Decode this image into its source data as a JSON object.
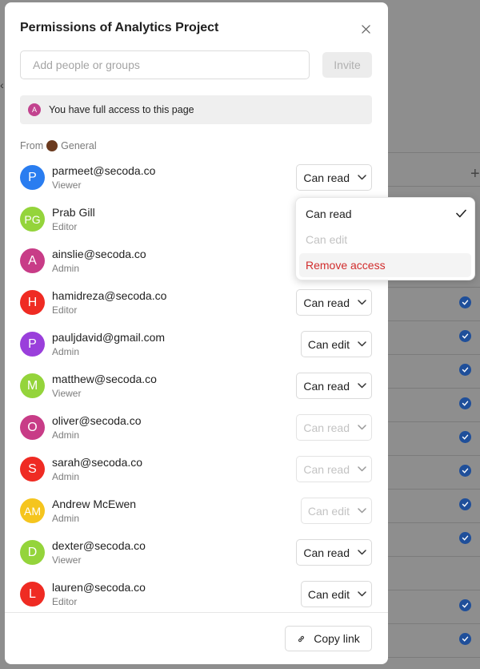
{
  "modal": {
    "title": "Permissions of Analytics Project",
    "search_placeholder": "Add people or groups",
    "invite_label": "Invite",
    "banner": {
      "avatar_letter": "A",
      "text": "You have full access to this page"
    },
    "from": {
      "prefix": "From",
      "source": "General"
    },
    "copy_link_label": "Copy link"
  },
  "members": [
    {
      "initials": "P",
      "name": "parmeet@secoda.co",
      "role": "Viewer",
      "permission": "Can read",
      "color": "#2a7df0"
    },
    {
      "initials": "PG",
      "name": "Prab Gill",
      "role": "Editor",
      "permission": "Can read",
      "color": "#94d43b"
    },
    {
      "initials": "A",
      "name": "ainslie@secoda.co",
      "role": "Admin",
      "permission": "Can read",
      "color": "#c83c87"
    },
    {
      "initials": "H",
      "name": "hamidreza@secoda.co",
      "role": "Editor",
      "permission": "Can read",
      "color": "#ef2b23"
    },
    {
      "initials": "P",
      "name": "pauljdavid@gmail.com",
      "role": "Admin",
      "permission": "Can edit",
      "color": "#9a3fdb"
    },
    {
      "initials": "M",
      "name": "matthew@secoda.co",
      "role": "Viewer",
      "permission": "Can read",
      "color": "#94d43b"
    },
    {
      "initials": "O",
      "name": "oliver@secoda.co",
      "role": "Admin",
      "permission": "Can read",
      "color": "#c83c87"
    },
    {
      "initials": "S",
      "name": "sarah@secoda.co",
      "role": "Admin",
      "permission": "Can read",
      "color": "#ef2b23"
    },
    {
      "initials": "AM",
      "name": "Andrew McEwen",
      "role": "Admin",
      "permission": "Can edit",
      "color": "#f5c51e"
    },
    {
      "initials": "D",
      "name": "dexter@secoda.co",
      "role": "Viewer",
      "permission": "Can read",
      "color": "#94d43b"
    },
    {
      "initials": "L",
      "name": "lauren@secoda.co",
      "role": "Editor",
      "permission": "Can edit",
      "color": "#ef2b23"
    }
  ],
  "dropdown": {
    "options": [
      "Can read",
      "Can edit",
      "Remove access"
    ],
    "selected": "Can read"
  }
}
